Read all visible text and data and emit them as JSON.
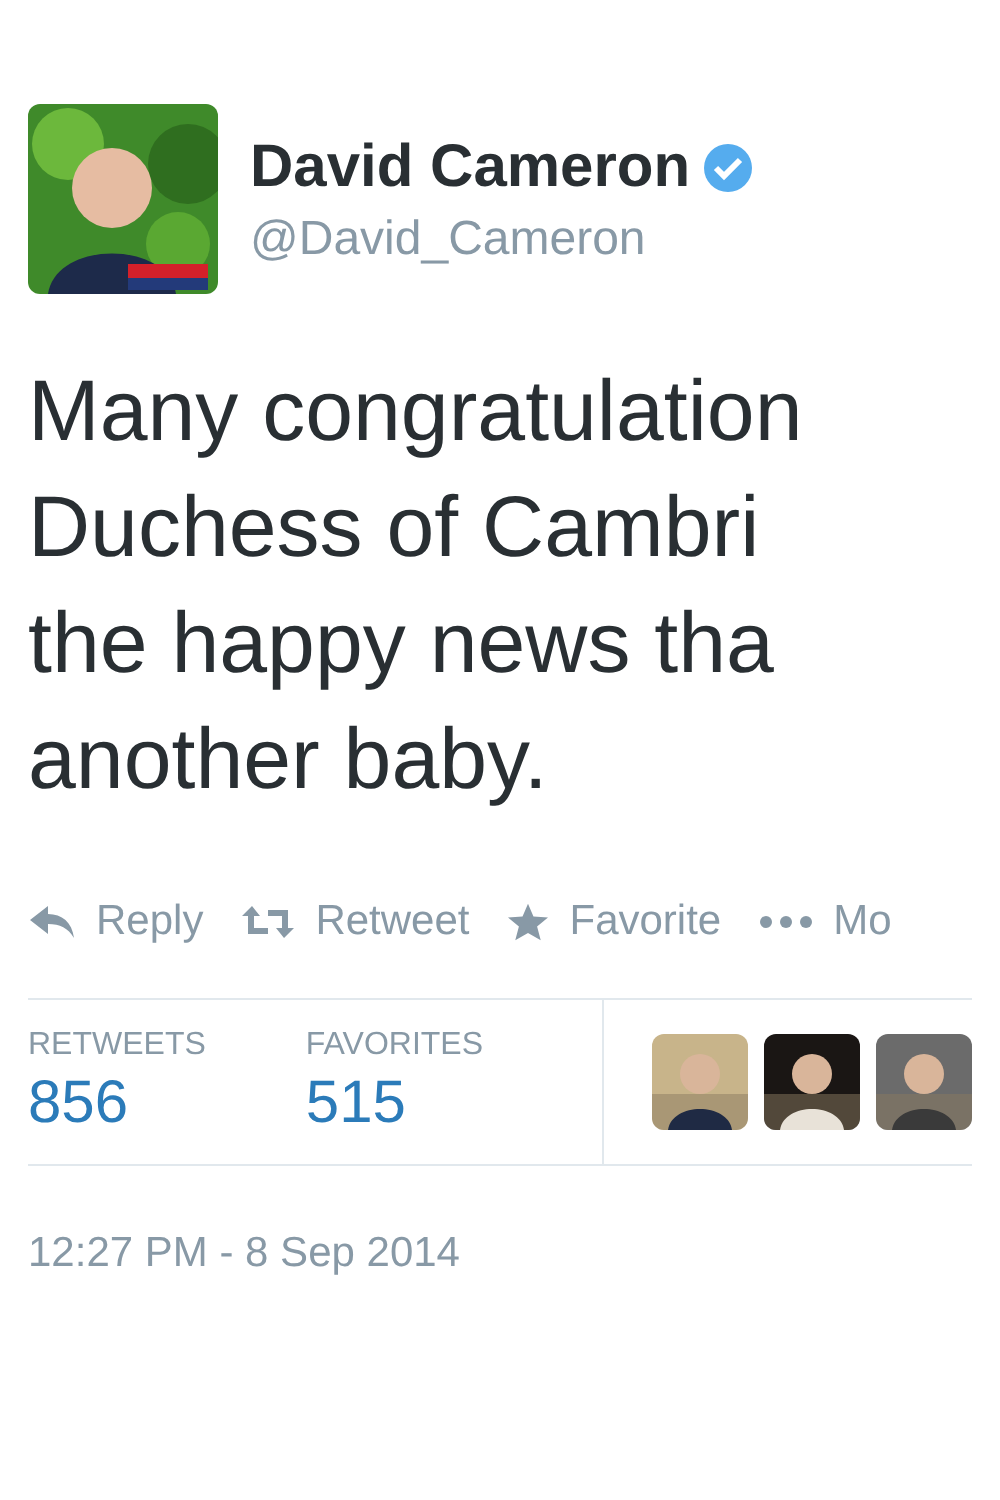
{
  "author": {
    "name": "David Cameron",
    "handle": "@David_Cameron",
    "verified": true
  },
  "tweet": {
    "lines": [
      "Many congratulation",
      "Duchess of Cambri",
      "the happy news tha",
      "another baby."
    ]
  },
  "actions": [
    {
      "kind": "reply",
      "label": "Reply"
    },
    {
      "kind": "retweet",
      "label": "Retweet"
    },
    {
      "kind": "favorite",
      "label": "Favorite"
    },
    {
      "kind": "more",
      "label": "Mo"
    }
  ],
  "stats": [
    {
      "label": "RETWEETS",
      "value": "856"
    },
    {
      "label": "FAVORITES",
      "value": "515"
    }
  ],
  "timestamp": "12:27 PM - 8 Sep 2014"
}
